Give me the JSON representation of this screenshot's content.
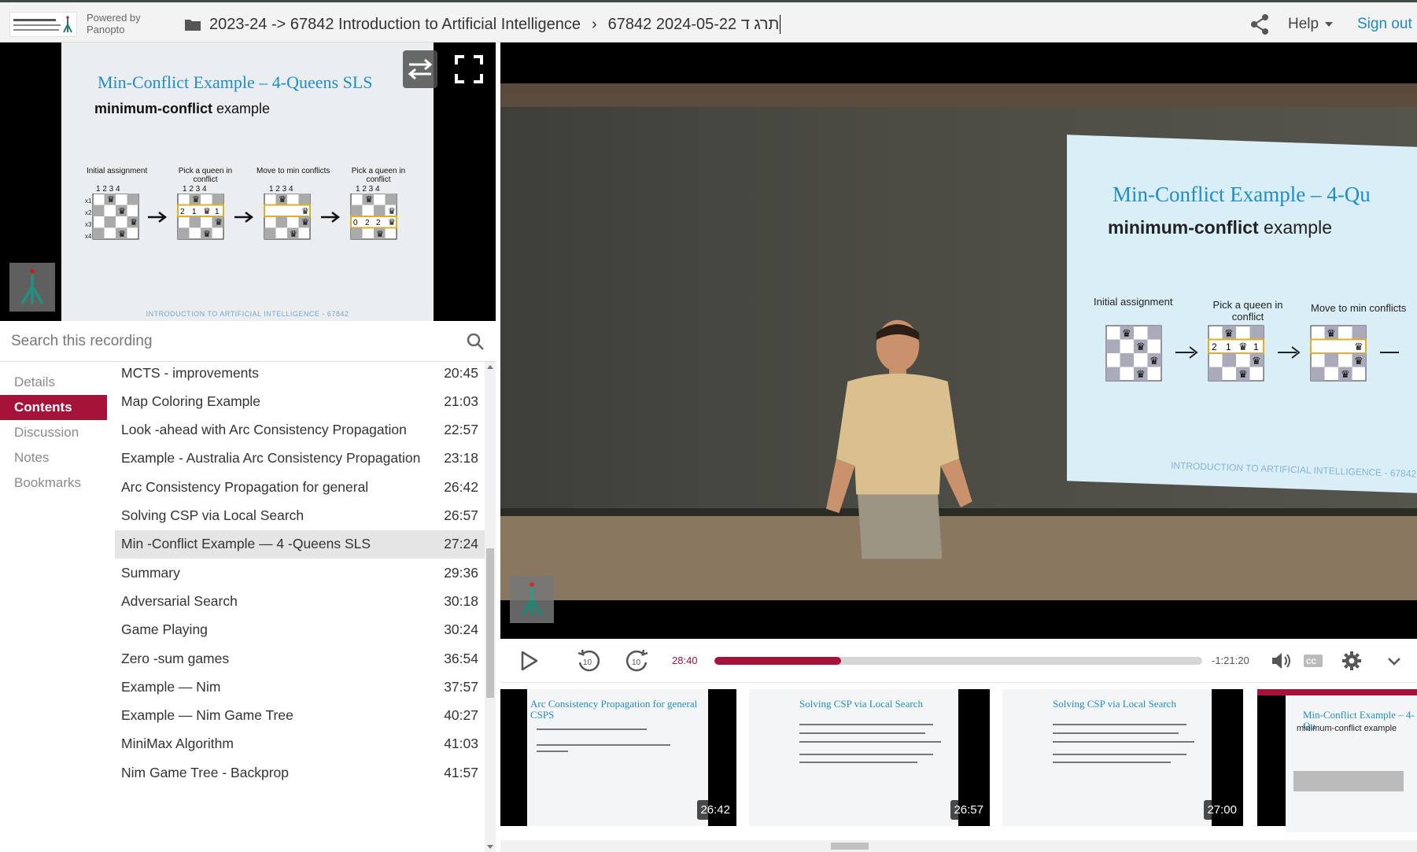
{
  "header": {
    "powered_by": "Powered by",
    "brand": "Panopto",
    "breadcrumb_folder": "2023-24 -> 67842 Introduction to Artificial Intelligence",
    "breadcrumb_session": "67842 2024-05-22 תרג ד",
    "help_label": "Help",
    "signout_label": "Sign out"
  },
  "slide": {
    "title": "Min-Conflict Example – 4-Queens SLS",
    "subtitle_bold": "minimum-conflict",
    "subtitle_rest": " example",
    "step_labels": [
      "Initial assignment",
      "Pick a queen in conflict",
      "Move to min conflicts",
      "Pick a queen in conflict"
    ],
    "col_numbers": "1 2 3 4",
    "footer": "INTRODUCTION TO ARTIFICIAL INTELLIGENCE - 67842"
  },
  "search": {
    "placeholder": "Search this recording"
  },
  "tabs": [
    {
      "label": "Details"
    },
    {
      "label": "Contents"
    },
    {
      "label": "Discussion"
    },
    {
      "label": "Notes"
    },
    {
      "label": "Bookmarks"
    }
  ],
  "active_tab": "Contents",
  "contents": [
    {
      "title": "MCTS - improvements",
      "time": "20:45"
    },
    {
      "title": "Map Coloring Example",
      "time": "21:03"
    },
    {
      "title": "Look -ahead with Arc Consistency Propagation",
      "time": "22:57"
    },
    {
      "title": "Example - Australia Arc Consistency Propagation",
      "time": "23:18"
    },
    {
      "title": "Arc Consistency Propagation for general",
      "time": "26:42"
    },
    {
      "title": "Solving CSP via Local Search",
      "time": "26:57"
    },
    {
      "title": "Min -Conflict Example — 4 -Queens SLS",
      "time": "27:24"
    },
    {
      "title": "Summary",
      "time": "29:36"
    },
    {
      "title": "Adversarial Search",
      "time": "30:18"
    },
    {
      "title": "Game Playing",
      "time": "30:24"
    },
    {
      "title": "Zero -sum games",
      "time": "36:54"
    },
    {
      "title": "Example — Nim",
      "time": "37:57"
    },
    {
      "title": "Example — Nim Game Tree",
      "time": "40:27"
    },
    {
      "title": "MiniMax Algorithm",
      "time": "41:03"
    },
    {
      "title": "Nim Game Tree - Backprop",
      "time": "41:57"
    }
  ],
  "selected_index": 6,
  "video": {
    "proj_title": "Min-Conflict Example – 4-Qu",
    "proj_sub_bold": "minimum-conflict",
    "proj_sub_rest": " example",
    "proj_labels": [
      "Initial assignment",
      "Pick a queen in conflict",
      "Move to min conflicts"
    ],
    "proj_footer": "INTRODUCTION TO ARTIFICIAL INTELLIGENCE - 67842"
  },
  "player": {
    "current_time": "28:40",
    "remaining_time": "-1:21:20",
    "progress_fraction": 0.26
  },
  "thumbnails": [
    {
      "title": "Arc Consistency Propagation for general CSPS",
      "time": "26:42"
    },
    {
      "title": "Solving CSP via Local Search",
      "time": "26:57"
    },
    {
      "title": "Solving CSP via Local Search",
      "time": "27:00"
    },
    {
      "title": "Min-Conflict Example – 4-Qu",
      "subtitle": "minimum-conflict example",
      "time": ""
    }
  ],
  "colors": {
    "accent": "#a5123a",
    "link": "#1e88c8",
    "slide_title": "#1f8dc8"
  },
  "icons": [
    "share-icon",
    "folder-icon",
    "search-icon",
    "swap-icon",
    "fullscreen-icon",
    "play-icon",
    "rewind-10-icon",
    "forward-10-icon",
    "volume-icon",
    "captions-icon",
    "settings-icon",
    "chevron-down-icon"
  ]
}
